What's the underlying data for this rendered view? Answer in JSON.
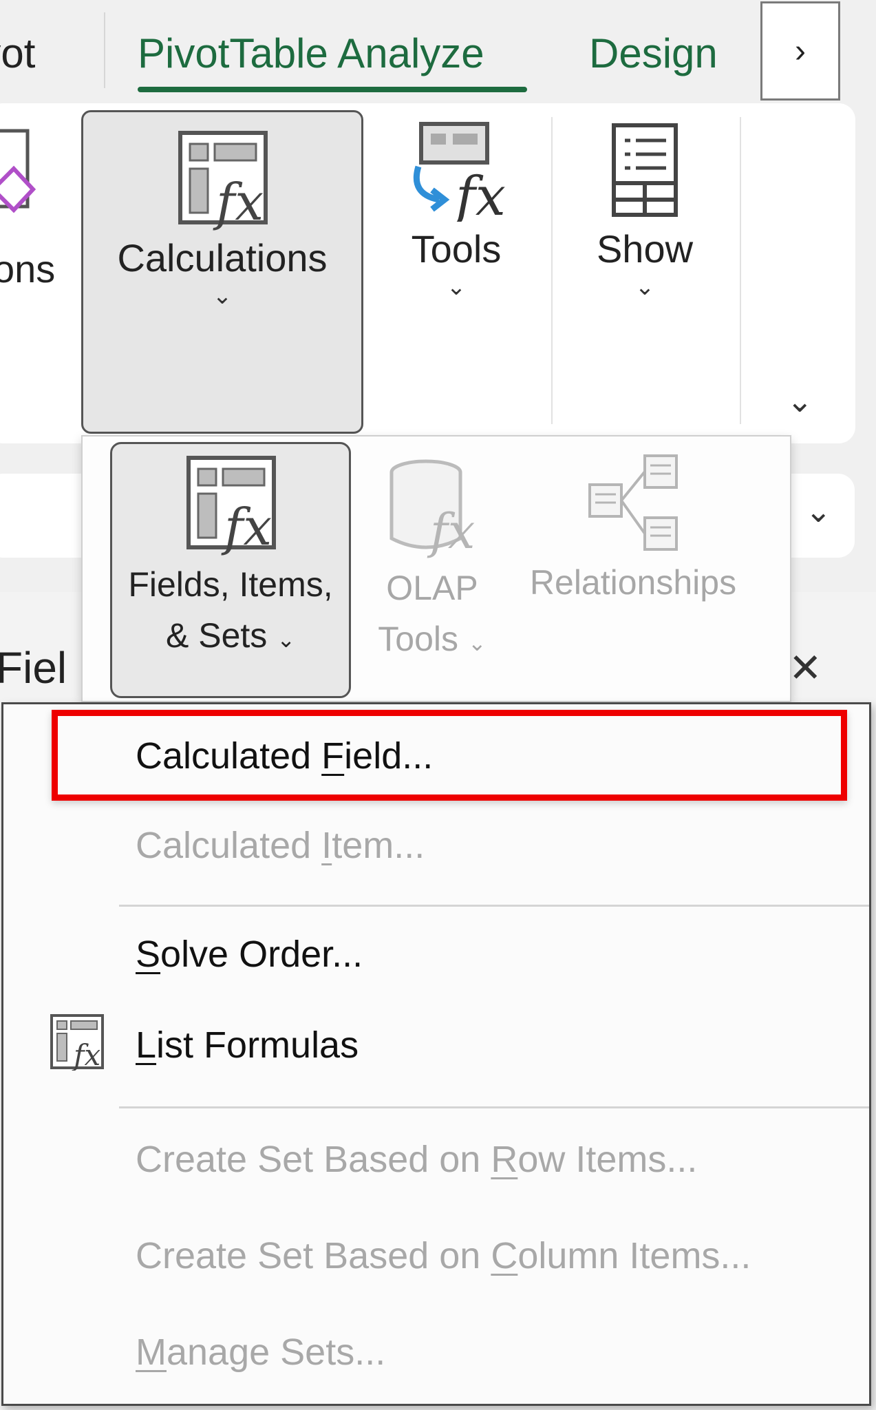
{
  "tabs": {
    "pivot_partial": "ivot",
    "analyze": "PivotTable Analyze",
    "design": "Design",
    "scroll_glyph": "›"
  },
  "ribbon": {
    "options_partial_label": "ons",
    "calculations": {
      "label": "Calculations",
      "icon": "calculations-fx-icon"
    },
    "tools": {
      "label": "Tools",
      "icon": "tools-fx-icon"
    },
    "show": {
      "label": "Show",
      "icon": "show-icon"
    },
    "chevron_glyph": "⌄",
    "collapse_glyph": "⌄"
  },
  "calculations_dropdown": {
    "fields_items_sets": {
      "label_line1": "Fields, Items,",
      "label_line2": "& Sets",
      "icon": "fields-items-sets-icon"
    },
    "olap_tools": {
      "label_line1": "OLAP",
      "label_line2": "Tools",
      "icon": "olap-cylinder-icon"
    },
    "relationships": {
      "label": "Relationships",
      "icon": "relationships-icon"
    },
    "small_chevron": "⌄"
  },
  "background": {
    "fields_pane_partial": "Fiel",
    "close_glyph": "✕",
    "namebox_chevron": "⌄"
  },
  "menu": {
    "calculated_field": {
      "pre": "Calculated ",
      "u": "F",
      "post": "ield..."
    },
    "calculated_item": {
      "pre": "Calculated ",
      "u": "I",
      "post": "tem..."
    },
    "solve_order": {
      "pre": "",
      "u": "S",
      "post": "olve Order..."
    },
    "list_formulas": {
      "pre": "",
      "u": "L",
      "post": "ist Formulas"
    },
    "create_set_row": {
      "pre": "Create Set Based on ",
      "u": "R",
      "post": "ow Items..."
    },
    "create_set_column": {
      "pre": "Create Set Based on ",
      "u": "C",
      "post": "olumn Items..."
    },
    "manage_sets": {
      "pre": "",
      "u": "M",
      "post": "anage Sets..."
    }
  },
  "colors": {
    "accent_green": "#1d6b3f",
    "highlight_red": "#ee0000",
    "tools_arrow_blue": "#2f8fd8",
    "options_diamond_purple": "#b04fc8"
  }
}
